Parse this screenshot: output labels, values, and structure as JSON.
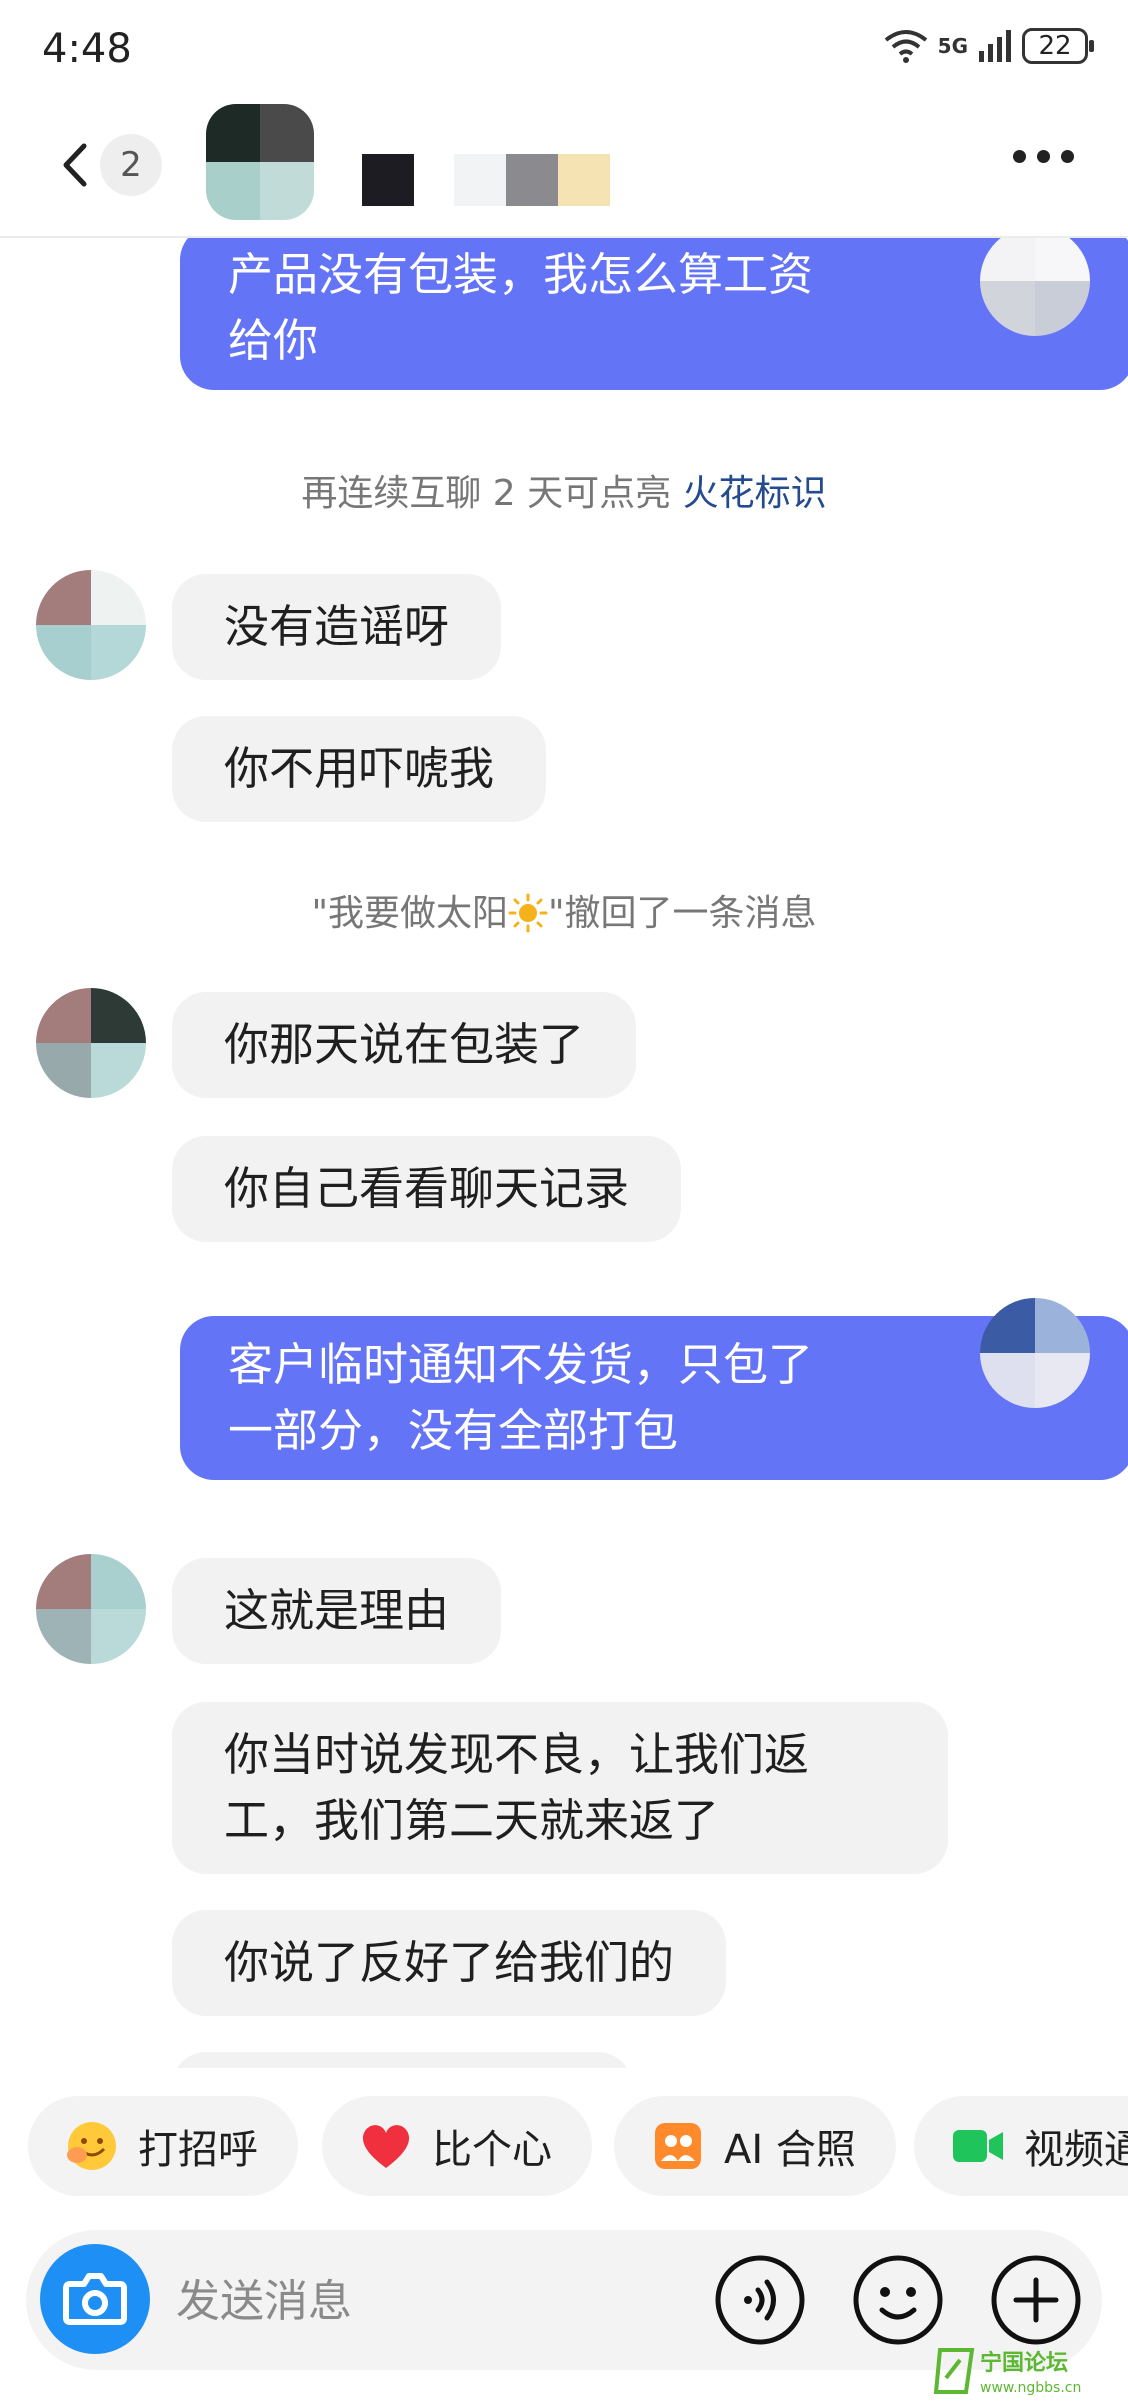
{
  "status_bar": {
    "time": "4:48",
    "network": "5G",
    "battery": "22"
  },
  "header": {
    "unread_count": "2",
    "more_icon": "more-dots-icon"
  },
  "colors": {
    "outgoing_bubble": "#6374f6",
    "incoming_bubble": "#f2f2f2",
    "highlight": "#244a8f",
    "camera": "#1e90f5"
  },
  "messages": [
    {
      "side": "out",
      "lines": [
        "产品没有包装，我怎么算工资",
        "给你"
      ]
    },
    {
      "side": "in",
      "lines": [
        "没有造谣呀"
      ]
    },
    {
      "side": "in",
      "lines": [
        "你不用吓唬我"
      ]
    },
    {
      "side": "in",
      "lines": [
        "你那天说在包装了"
      ]
    },
    {
      "side": "in",
      "lines": [
        "你自己看看聊天记录"
      ]
    },
    {
      "side": "out",
      "lines": [
        "客户临时通知不发货，只包了",
        "一部分，没有全部打包"
      ]
    },
    {
      "side": "in",
      "lines": [
        "这就是理由"
      ]
    },
    {
      "side": "in",
      "lines": [
        "你当时说发现不良，让我们返",
        "工，我们第二天就来返了"
      ]
    },
    {
      "side": "in",
      "lines": [
        "你说了反好了给我们的"
      ]
    }
  ],
  "system": {
    "spark_prefix": "再连续互聊 2 天可点亮 ",
    "spark_link": "火花标识",
    "recall_prefix": "\"我要做太阳",
    "recall_suffix": "\"撤回了一条消息"
  },
  "quick_replies": [
    {
      "label": "打招呼",
      "icon": "wave-emoji-icon"
    },
    {
      "label": "比个心",
      "icon": "heart-icon"
    },
    {
      "label": "AI 合照",
      "icon": "ai-photo-icon"
    },
    {
      "label": "视频通",
      "icon": "video-call-icon"
    }
  ],
  "input": {
    "placeholder": "发送消息"
  },
  "watermark": {
    "name": "宁国论坛",
    "url": "www.ngbbs.cn"
  }
}
